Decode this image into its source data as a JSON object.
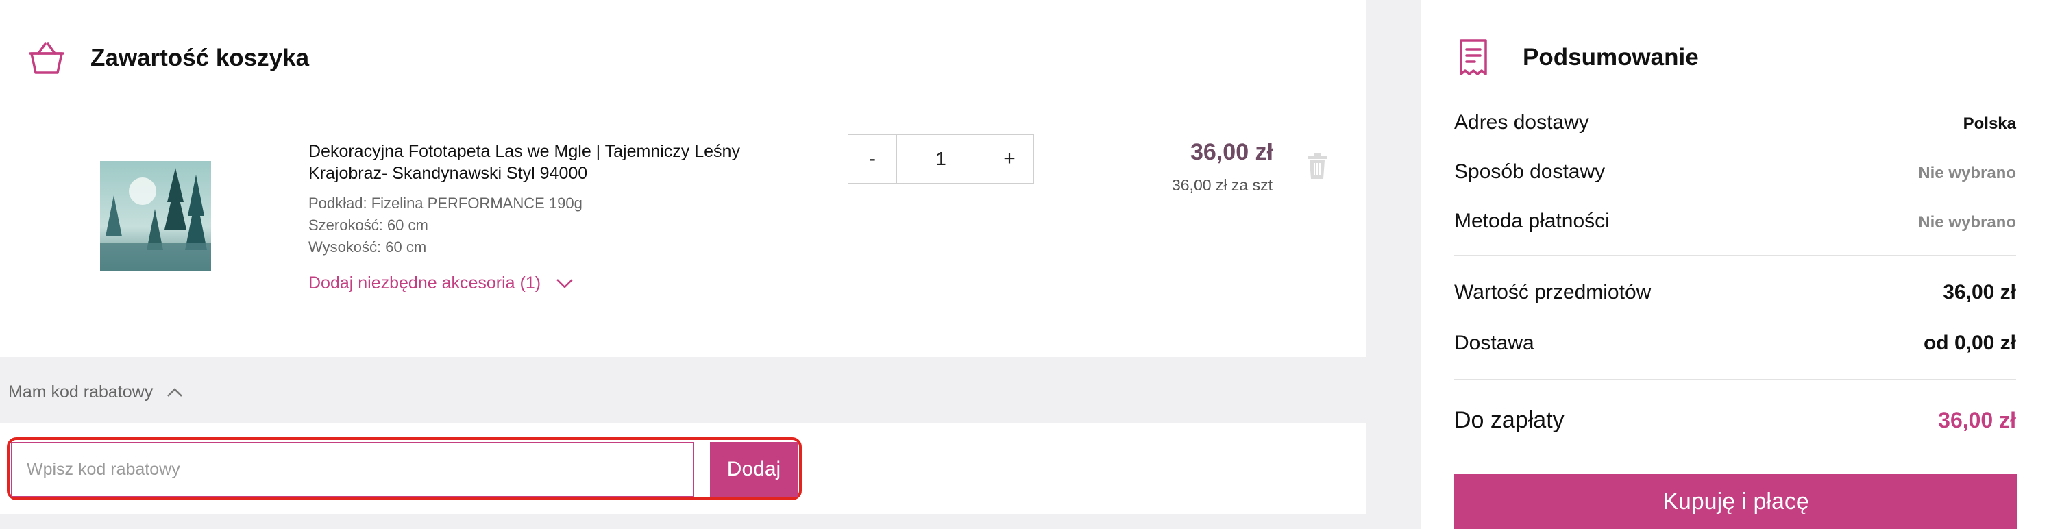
{
  "cart": {
    "title": "Zawartość koszyka",
    "item": {
      "name": "Dekoracyjna Fototapeta Las we Mgle | Tajemniczy Leśny Krajobraz- Skandynawski Styl 94000",
      "attrs": [
        "Podkład: Fizelina PERFORMANCE 190g",
        "Szerokość: 60 cm",
        "Wysokość: 60 cm"
      ],
      "accessories_label": "Dodaj niezbędne akcesoria (1)",
      "qty_minus": "-",
      "qty_plus": "+",
      "quantity": "1",
      "price": "36,00 zł",
      "unit_price": "36,00 zł za szt"
    }
  },
  "discount": {
    "toggle_label": "Mam kod rabatowy",
    "placeholder": "Wpisz kod rabatowy",
    "apply_label": "Dodaj"
  },
  "summary": {
    "title": "Podsumowanie",
    "delivery_address_label": "Adres dostawy",
    "delivery_address_value": "Polska",
    "shipping_method_label": "Sposób dostawy",
    "shipping_method_value": "Nie wybrano",
    "payment_method_label": "Metoda płatności",
    "payment_method_value": "Nie wybrano",
    "items_value_label": "Wartość przedmiotów",
    "items_value": "36,00 zł",
    "shipping_label": "Dostawa",
    "shipping_value": "od 0,00 zł",
    "total_label": "Do zapłaty",
    "total_value": "36,00 zł",
    "buy_label": "Kupuję i płacę"
  },
  "colors": {
    "accent": "#c43e82",
    "price": "#6e4a63",
    "highlight": "#e2261f",
    "background": "#f0f0f2"
  }
}
